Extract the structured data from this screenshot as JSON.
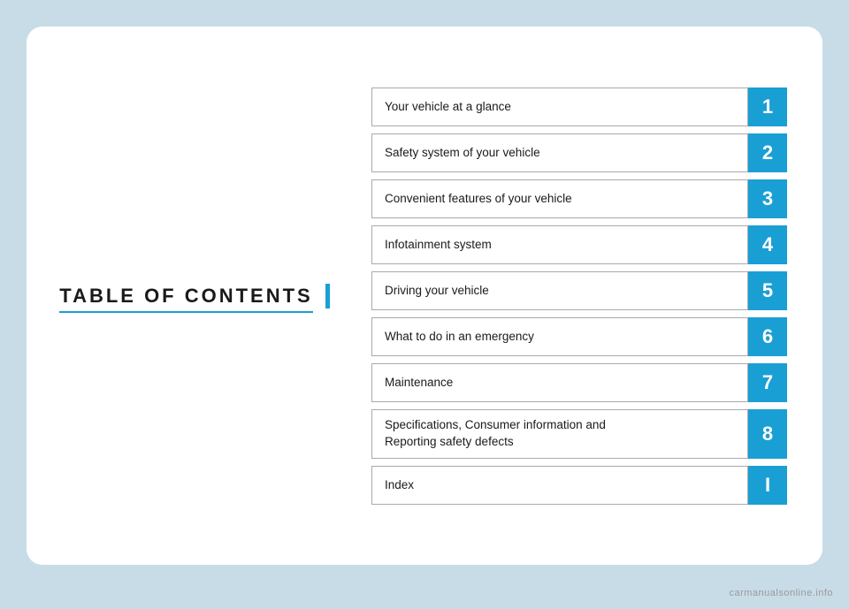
{
  "page": {
    "background_color": "#c8dce8",
    "card_background": "#ffffff"
  },
  "left_panel": {
    "title": "TABLE OF CONTENTS",
    "accent_color": "#1a9fd4"
  },
  "toc": {
    "items": [
      {
        "label": "Your vehicle at a glance",
        "number": "1",
        "tall": false
      },
      {
        "label": "Safety system of your vehicle",
        "number": "2",
        "tall": false
      },
      {
        "label": "Convenient features of your vehicle",
        "number": "3",
        "tall": false
      },
      {
        "label": "Infotainment system",
        "number": "4",
        "tall": false
      },
      {
        "label": "Driving your vehicle",
        "number": "5",
        "tall": false
      },
      {
        "label": "What to do in an emergency",
        "number": "6",
        "tall": false
      },
      {
        "label": "Maintenance",
        "number": "7",
        "tall": false
      },
      {
        "label": "Specifications, Consumer information and\nReporting safety defects",
        "number": "8",
        "tall": true
      },
      {
        "label": "Index",
        "number": "I",
        "tall": false
      }
    ]
  },
  "watermark": {
    "text": "carmanualsonline.info"
  }
}
